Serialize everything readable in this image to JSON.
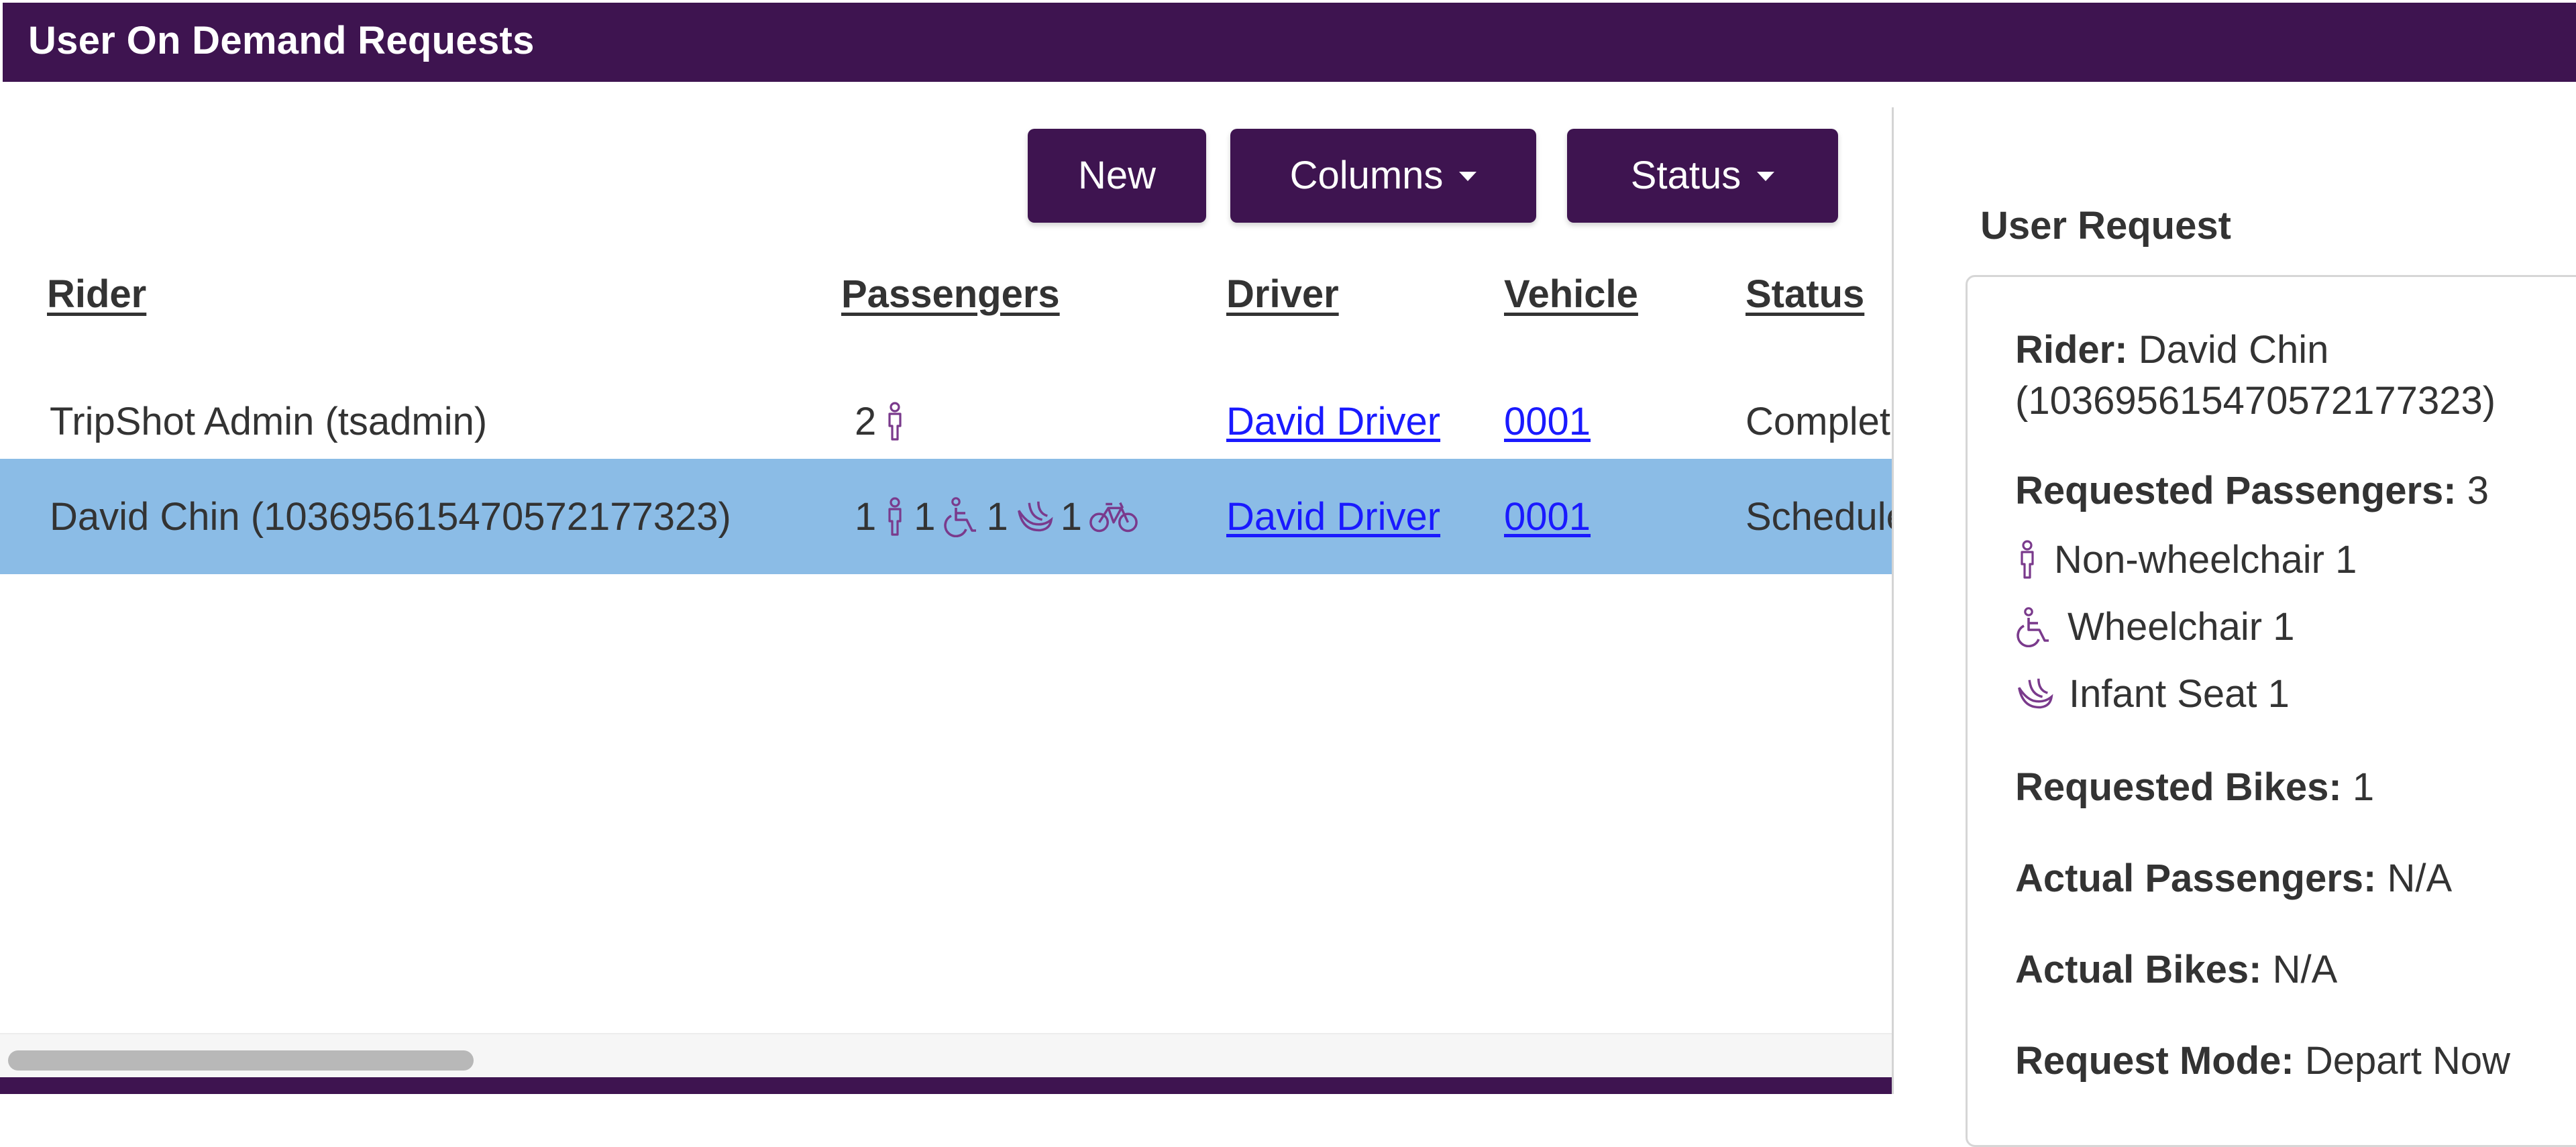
{
  "window": {
    "title": "User On Demand Requests"
  },
  "toolbar": {
    "new_label": "New",
    "columns_label": "Columns",
    "status_label": "Status"
  },
  "table": {
    "headers": {
      "rider": "Rider",
      "passengers": "Passengers",
      "driver": "Driver",
      "vehicle": "Vehicle",
      "status": "Status"
    },
    "rows": [
      {
        "rider": "TripShot Admin (tsadmin)",
        "passengers": {
          "non_wheelchair": "2"
        },
        "driver": "David Driver",
        "vehicle": "0001",
        "status": "Completed",
        "selected": false
      },
      {
        "rider": "David Chin (103695615470572177323)",
        "passengers": {
          "non_wheelchair": "1",
          "wheelchair": "1",
          "infant_seat": "1",
          "bikes": "1"
        },
        "driver": "David Driver",
        "vehicle": "0001",
        "status": "Scheduled",
        "selected": true
      }
    ]
  },
  "detail": {
    "heading": "User Request",
    "rider_label": "Rider:",
    "rider_name": "David Chin",
    "rider_id": "(103695615470572177323)",
    "requested_passengers_label": "Requested Passengers:",
    "requested_passengers_value": "3",
    "passenger_types": [
      {
        "label": "Non-wheelchair 1",
        "icon": "person-icon"
      },
      {
        "label": "Wheelchair 1",
        "icon": "wheelchair-icon"
      },
      {
        "label": "Infant Seat 1",
        "icon": "infant-seat-icon"
      }
    ],
    "requested_bikes_label": "Requested Bikes:",
    "requested_bikes_value": "1",
    "actual_passengers_label": "Actual Passengers:",
    "actual_passengers_value": "N/A",
    "actual_bikes_label": "Actual Bikes:",
    "actual_bikes_value": "N/A",
    "request_mode_label": "Request Mode:",
    "request_mode_value": "Depart Now"
  },
  "colors": {
    "brand_purple": "#3e1450",
    "icon_purple": "#7a3a8c",
    "selected_row": "#8bbce6",
    "link_blue": "#1a1aff"
  }
}
